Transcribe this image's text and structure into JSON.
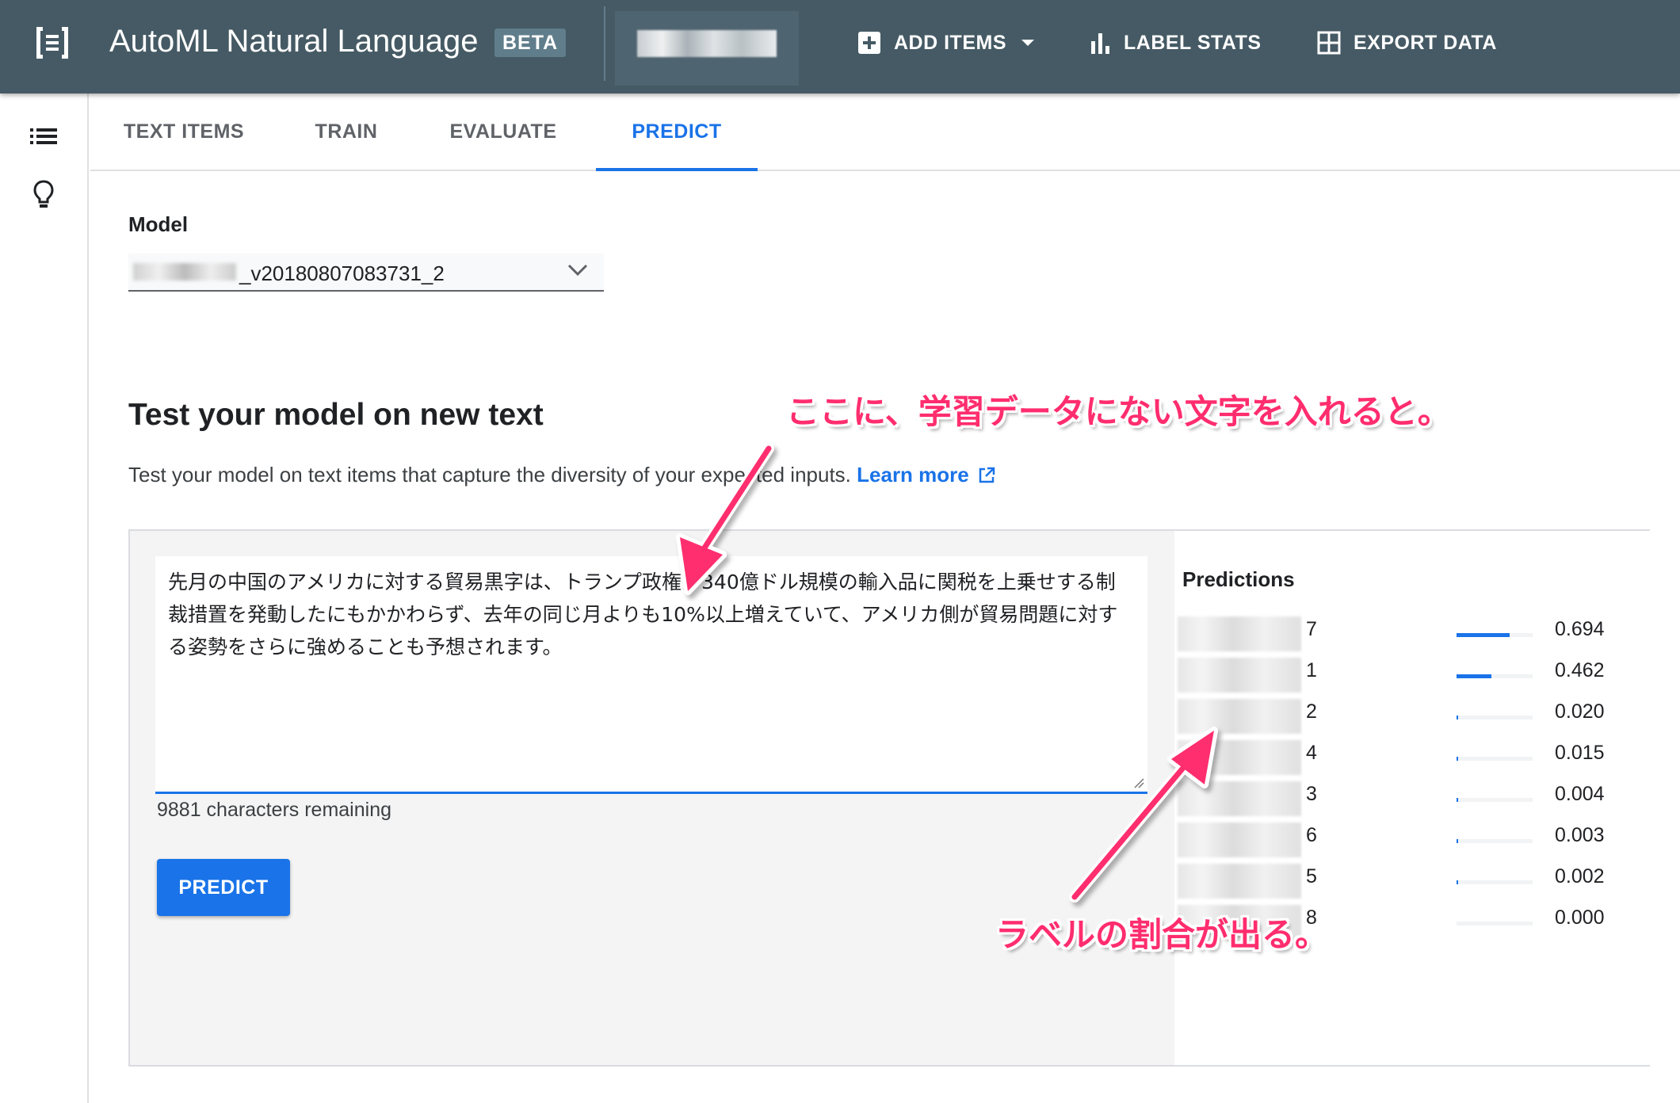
{
  "header": {
    "app_title": "AutoML Natural Language",
    "badge": "BETA",
    "dataset_name": "",
    "buttons": {
      "add_items": "ADD ITEMS",
      "label_stats": "LABEL STATS",
      "export_data": "EXPORT DATA"
    }
  },
  "tabs": [
    {
      "label": "TEXT ITEMS",
      "active": false
    },
    {
      "label": "TRAIN",
      "active": false
    },
    {
      "label": "EVALUATE",
      "active": false
    },
    {
      "label": "PREDICT",
      "active": true
    }
  ],
  "model": {
    "label": "Model",
    "selected_value": "_v20180807083731_2"
  },
  "section": {
    "title": "Test your model on new text",
    "description": "Test your model on text items that capture the diversity of your expected inputs.",
    "learn_more": "Learn more"
  },
  "input": {
    "value": "先月の中国のアメリカに対する貿易黒字は、トランプ政権が340億ドル規模の輸入品に関税を上乗せする制裁措置を発動したにもかかわらず、去年の同じ月よりも10%以上増えていて、アメリカ側が貿易問題に対する姿勢をさらに強めることも予想されます。",
    "chars_remaining": "9881 characters remaining"
  },
  "predict_button": "PREDICT",
  "predictions": {
    "title": "Predictions",
    "items": [
      {
        "label_suffix": "7",
        "score": 0.694,
        "score_text": "0.694"
      },
      {
        "label_suffix": "1",
        "score": 0.462,
        "score_text": "0.462"
      },
      {
        "label_suffix": "2",
        "score": 0.02,
        "score_text": "0.020"
      },
      {
        "label_suffix": "4",
        "score": 0.015,
        "score_text": "0.015"
      },
      {
        "label_suffix": "3",
        "score": 0.004,
        "score_text": "0.004"
      },
      {
        "label_suffix": "6",
        "score": 0.003,
        "score_text": "0.003"
      },
      {
        "label_suffix": "5",
        "score": 0.002,
        "score_text": "0.002"
      },
      {
        "label_suffix": "8",
        "score": 0.0,
        "score_text": "0.000"
      }
    ]
  },
  "annotations": {
    "top": "ここに、学習データにない文字を入れると。",
    "bottom": "ラベルの割合が出る。"
  },
  "colors": {
    "header_bg": "#455a64",
    "accent": "#1a73e8",
    "annotation": "#ff2d6e"
  }
}
